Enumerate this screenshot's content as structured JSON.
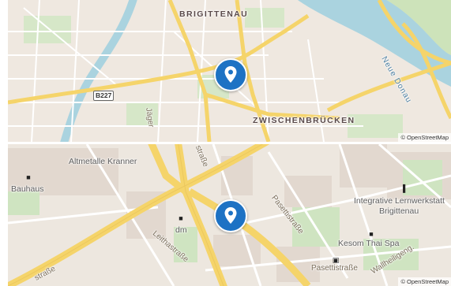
{
  "maps": [
    {
      "labels": {
        "district_brigittenau": "BRIGITTENAU",
        "district_zwischenbruecken": "ZWISCHENBRÜCKEN",
        "road_b227": "B227",
        "street_jaeger": "Jäger",
        "river_neue_donau": "Neue Donau"
      },
      "attribution": "© OpenStreetMap"
    },
    {
      "labels": {
        "poi_altmetalle": "Altmetalle Kranner",
        "poi_bauhaus": "Bauhaus",
        "poi_dm": "dm",
        "poi_lernwerkstatt_line1": "Integrative Lernwerkstatt",
        "poi_lernwerkstatt_line2": "Brigittenau",
        "poi_kesom": "Kesom Thai Spa",
        "street_leithastrasse": "Leithastraße",
        "street_pasettistrasse_diag": "Pasettistraße",
        "street_pasettistrasse": "Pasettistraße",
        "street_strasse_top": "straße",
        "street_strasse_left": "straße",
        "street_heiligeng": "Wallheiligeng."
      },
      "attribution": "© OpenStreetMap"
    }
  ],
  "colors": {
    "pin": "#1d72c4",
    "water": "#aad3df",
    "major_road": "#f5d46a",
    "land": "#efe8e0",
    "park": "#d6e7c8"
  },
  "icons": {
    "pin": "location-pin-icon",
    "shop": "shopping-bag-icon",
    "school": "school-icon",
    "fuel": "fuel-icon"
  }
}
